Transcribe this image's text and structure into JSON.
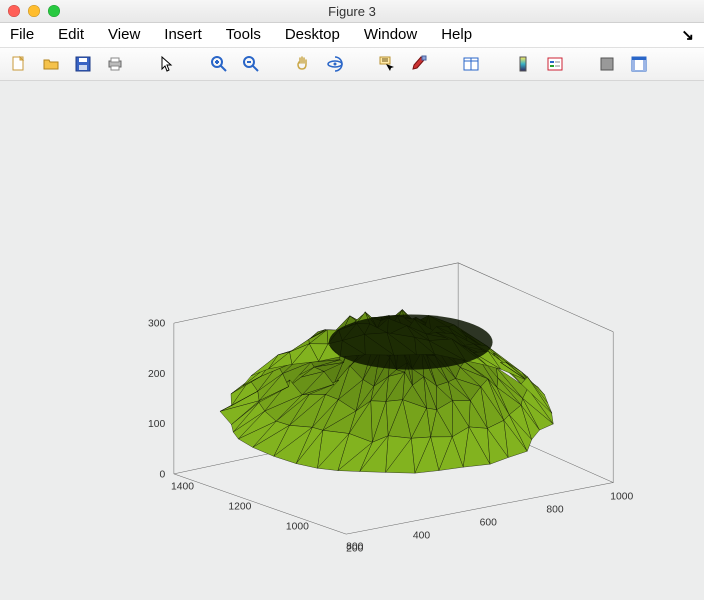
{
  "window": {
    "title": "Figure 3"
  },
  "menus": [
    "File",
    "Edit",
    "View",
    "Insert",
    "Tools",
    "Desktop",
    "Window",
    "Help"
  ],
  "toolbar_icons": [
    "new-figure-icon",
    "open-icon",
    "save-icon",
    "print-icon",
    "|",
    "pointer-icon",
    "|",
    "zoom-in-icon",
    "zoom-out-icon",
    "|",
    "pan-icon",
    "rotate3d-icon",
    "|",
    "datacursor-icon",
    "brush-icon",
    "|",
    "link-icon",
    "|",
    "colorbar-icon",
    "legend-icon",
    "|",
    "hide-plot-tools-icon",
    "show-plot-tools-icon"
  ],
  "plot3d": {
    "z_ticks": [
      0,
      100,
      200,
      300
    ],
    "x_ticks": [
      800,
      1000,
      1200,
      1400
    ],
    "y_ticks": [
      200,
      400,
      600,
      800,
      1000
    ],
    "surface_color": "#8fc423",
    "edge_color": "#000000"
  },
  "chart_data": {
    "type": "surface",
    "x_range": [
      800,
      1400
    ],
    "y_range": [
      200,
      1000
    ],
    "z_range": [
      0,
      300
    ],
    "title": "",
    "xlabel": "",
    "ylabel": "",
    "zlabel": "",
    "description": "3D triangulated mesh surface; roughly dome-shaped blob rising from z≈0 base to z≈250-300 near center, spanning x≈800-1400 and y≈200-1000; rendered with green faces and black edges."
  }
}
